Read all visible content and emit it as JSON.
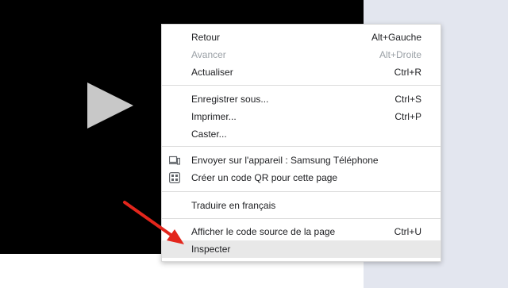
{
  "icons": {
    "play": "play-icon",
    "device": "device-icon",
    "qr": "qr-code-icon",
    "arrow": "red-arrow-icon"
  },
  "colors": {
    "arrow": "#e3261c",
    "menu_bg": "#ffffff",
    "selected_bg": "#e8e8e8"
  },
  "menu": {
    "back": {
      "label": "Retour",
      "shortcut": "Alt+Gauche"
    },
    "forward": {
      "label": "Avancer",
      "shortcut": "Alt+Droite"
    },
    "reload": {
      "label": "Actualiser",
      "shortcut": "Ctrl+R"
    },
    "save_as": {
      "label": "Enregistrer sous...",
      "shortcut": "Ctrl+S"
    },
    "print": {
      "label": "Imprimer...",
      "shortcut": "Ctrl+P"
    },
    "cast": {
      "label": "Caster..."
    },
    "send_device": {
      "label": "Envoyer sur l'appareil : Samsung Téléphone"
    },
    "qr_code": {
      "label": "Créer un code QR pour cette page"
    },
    "translate": {
      "label": "Traduire en français"
    },
    "view_source": {
      "label": "Afficher le code source de la page",
      "shortcut": "Ctrl+U"
    },
    "inspect": {
      "label": "Inspecter"
    }
  }
}
